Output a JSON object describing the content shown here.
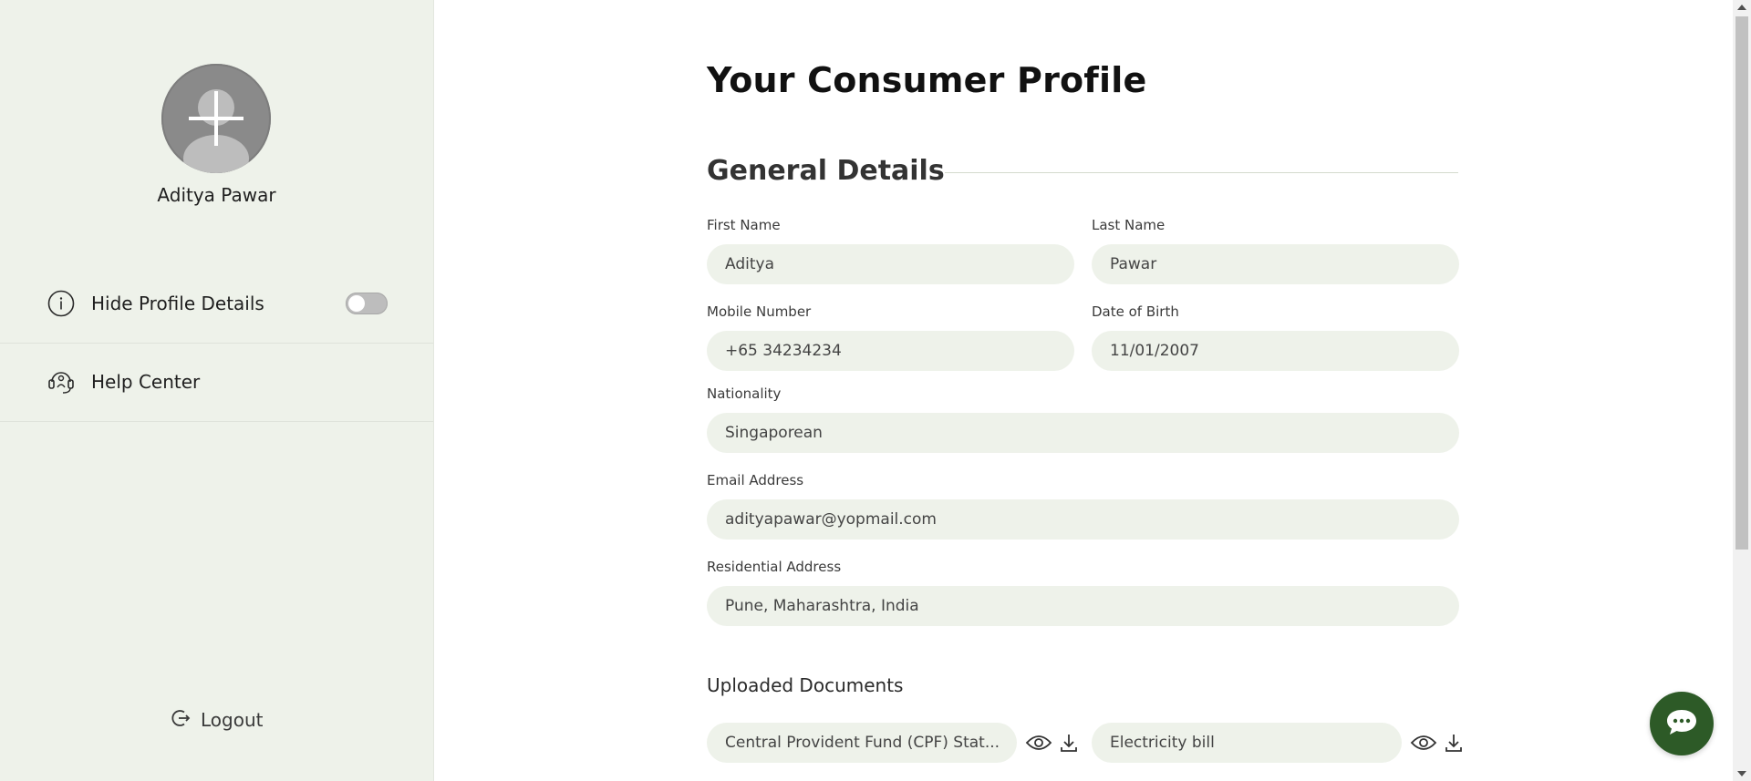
{
  "sidebar": {
    "user_name": "Aditya Pawar",
    "items": [
      {
        "label": "Hide Profile Details",
        "icon": "info-icon",
        "toggle_on": false
      },
      {
        "label": "Help Center",
        "icon": "headset-icon"
      }
    ],
    "logout_label": "Logout"
  },
  "main": {
    "page_title": "Your Consumer Profile",
    "section_title": "General Details",
    "fields": {
      "first_name": {
        "label": "First Name",
        "value": "Aditya"
      },
      "last_name": {
        "label": "Last Name",
        "value": "Pawar"
      },
      "mobile": {
        "label": "Mobile Number",
        "value": "+65 34234234"
      },
      "dob": {
        "label": "Date of Birth",
        "value": "11/01/2007"
      },
      "nationality": {
        "label": "Nationality",
        "value": "Singaporean"
      },
      "email": {
        "label": "Email Address",
        "value": "adityapawar@yopmail.com"
      },
      "address": {
        "label": "Residential Address",
        "value": "Pune, Maharashtra, India"
      }
    },
    "documents": {
      "title": "Uploaded Documents",
      "items": [
        {
          "name": "Central Provident Fund (CPF) Stat..."
        },
        {
          "name": "Electricity bill"
        }
      ]
    }
  },
  "colors": {
    "sidebar_bg": "#eef2ea",
    "field_bg": "#eef2ea",
    "chat_button": "#2d5a27"
  }
}
